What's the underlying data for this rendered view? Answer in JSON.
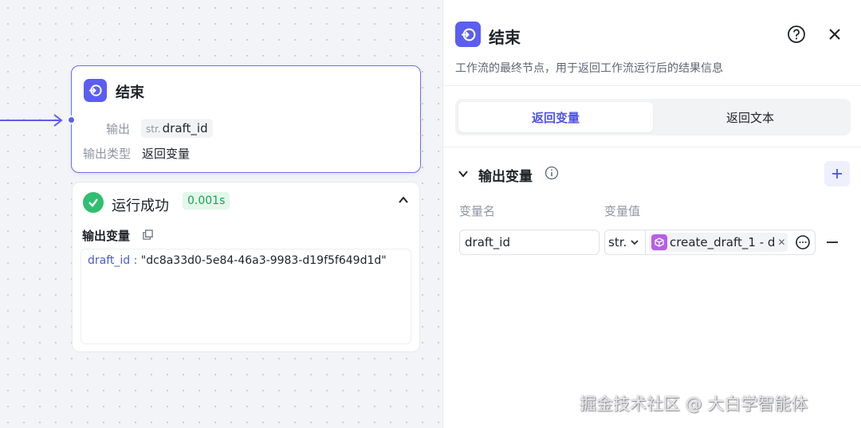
{
  "node": {
    "title": "结束",
    "output_label": "输出",
    "output_type_prefix": "str.",
    "output_var": "draft_id",
    "output_type_label": "输出类型",
    "output_type_value": "返回变量"
  },
  "run_result": {
    "status": "运行成功",
    "duration": "0.001s",
    "output_section_label": "输出变量",
    "output_key": "draft_id",
    "output_separator": " : ",
    "output_value": "\"dc8a33d0-5e84-46a3-9983-d19f5f649d1d\""
  },
  "panel": {
    "title": "结束",
    "description": "工作流的最终节点，用于返回工作流运行后的结果信息",
    "tabs": [
      {
        "label": "返回变量",
        "active": true
      },
      {
        "label": "返回文本",
        "active": false
      }
    ],
    "section_title": "输出变量",
    "column_name": "变量名",
    "column_value": "变量值",
    "variables": [
      {
        "name": "draft_id",
        "type": "str.",
        "ref": "create_draft_1 - d"
      }
    ]
  },
  "watermark": "掘金技术社区 @ 大白学智能体",
  "colors": {
    "accent": "#5b5ef0",
    "success": "#2fbf71",
    "ref_icon": "#b65ee8"
  },
  "icons": [
    "end-node-icon",
    "success-check-icon",
    "chevron-up-icon",
    "copy-icon",
    "help-icon",
    "close-icon",
    "chevron-down-icon",
    "info-icon",
    "plus-icon",
    "cube-icon",
    "variable-pick-icon",
    "minus-icon"
  ]
}
